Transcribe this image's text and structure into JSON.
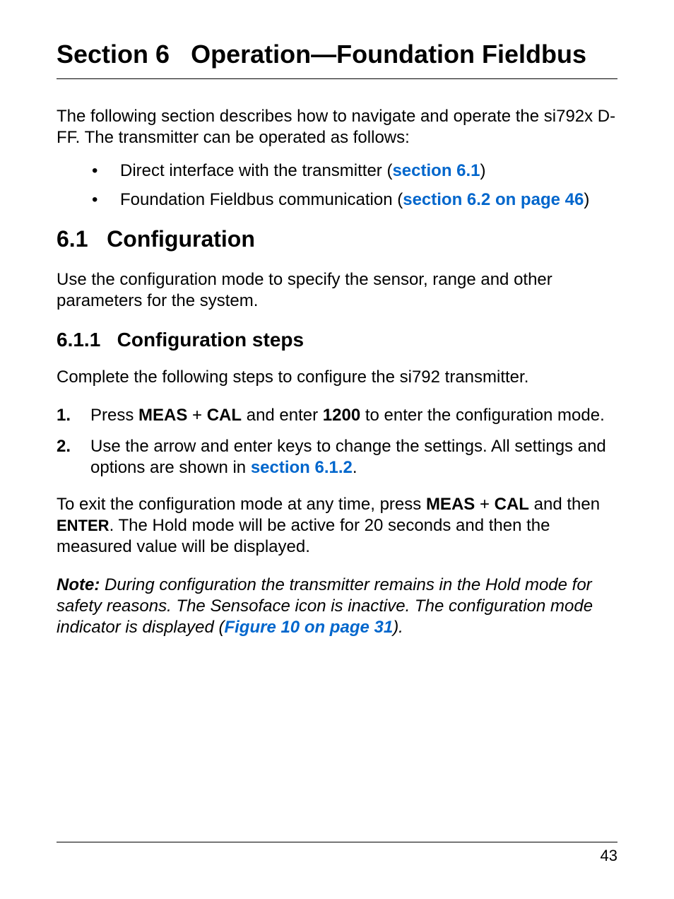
{
  "title": {
    "section_label": "Section 6",
    "section_name": "Operation—Foundation Fieldbus"
  },
  "intro": "The following section describes how to navigate and operate the si792x D-FF. The transmitter can be operated as follows:",
  "bullets": [
    {
      "text_before": "Direct interface with the transmitter (",
      "link": "section 6.1",
      "text_after": ")"
    },
    {
      "text_before": "Foundation Fieldbus communication (",
      "link": "section 6.2 on page 46",
      "text_after": ")"
    }
  ],
  "h2": {
    "number": "6.1",
    "title": "Configuration"
  },
  "h2_para": "Use the configuration mode to specify the sensor, range and other parameters for the system.",
  "h3": {
    "number": "6.1.1",
    "title": "Configuration steps"
  },
  "h3_para": "Complete the following steps to configure the si792 transmitter.",
  "steps": [
    {
      "num": "1.",
      "parts": {
        "p1": "Press ",
        "b1": "MEAS",
        "p2": " + ",
        "b2": "CAL",
        "p3": " and enter ",
        "b3": "1200",
        "p4": " to enter the configuration mode."
      }
    },
    {
      "num": "2.",
      "parts": {
        "p1": "Use the arrow and enter keys to change the settings. All settings and options are shown in ",
        "link": "section 6.1.2",
        "p2": "."
      }
    }
  ],
  "exit_para": {
    "p1": "To exit the configuration mode at any time, press ",
    "b1": "MEAS",
    "p2": " + ",
    "b2": "CAL",
    "p3": " and then ",
    "sc1": "ENTER",
    "p4": ". The Hold mode will be active for 20 seconds and then the measured value will be displayed."
  },
  "note": {
    "label": "Note:",
    "p1": " During configuration the transmitter remains in the Hold mode for safety reasons. The Sensoface icon is inactive. The configuration mode indicator is displayed (",
    "link": "Figure 10 on page 31",
    "p2": ")."
  },
  "page_number": "43"
}
